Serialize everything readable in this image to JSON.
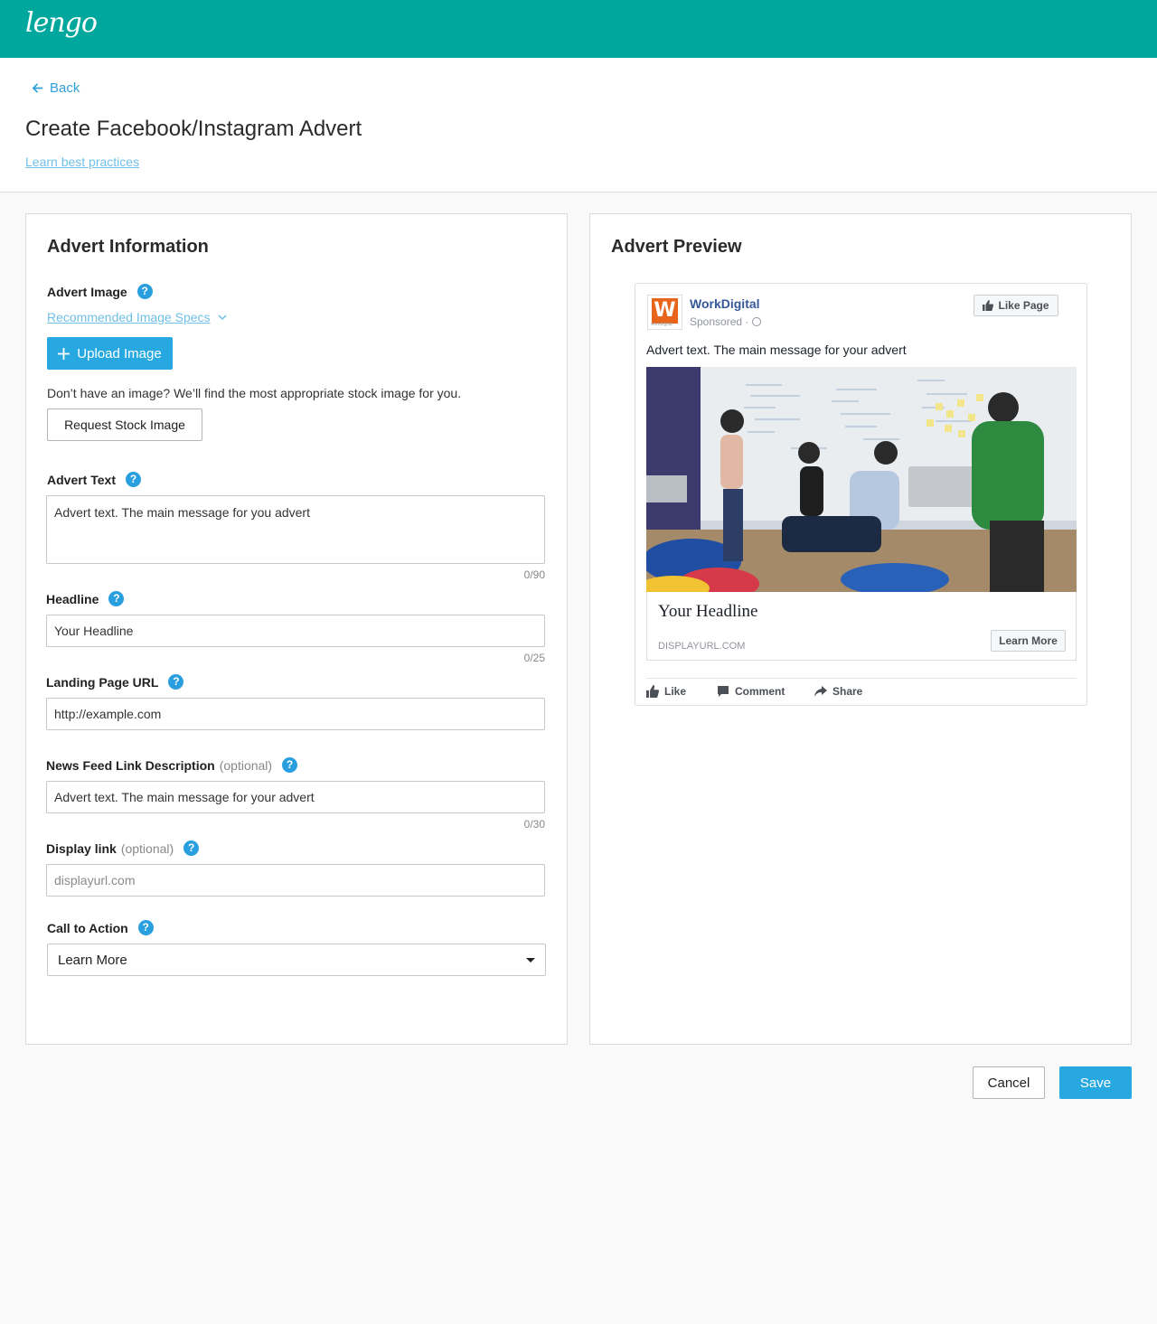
{
  "app": {
    "logo": "lengo"
  },
  "header": {
    "back_label": "Back",
    "title": "Create Facebook/Instagram Advert",
    "best_practices_link": "Learn best practices"
  },
  "form": {
    "title": "Advert Information",
    "advert_image": {
      "label": "Advert Image",
      "specs_link": "Recommended Image Specs",
      "upload_label": "Upload Image",
      "stock_note": "Don’t have an image? We’ll find the most appropriate stock image for you.",
      "stock_button": "Request Stock Image"
    },
    "advert_text": {
      "label": "Advert Text",
      "value": "Advert text. The main message for you advert",
      "counter": "0/90"
    },
    "headline": {
      "label": "Headline",
      "value": "Your Headline",
      "counter": "0/25"
    },
    "landing_url": {
      "label": "Landing Page URL",
      "value": "http://example.com"
    },
    "news_feed_desc": {
      "label": "News Feed Link Description",
      "optional": "(optional)",
      "value": "Advert text. The main message for your advert",
      "counter": "0/30"
    },
    "display_link": {
      "label": "Display link",
      "optional": "(optional)",
      "value": "",
      "placeholder": "displayurl.com"
    },
    "call_to_action": {
      "label": "Call to Action",
      "selected": "Learn More"
    }
  },
  "preview": {
    "title": "Advert Preview",
    "page_name": "WorkDigital",
    "logo_letter": "W",
    "logo_sub": "workdigital",
    "sponsored": "Sponsored ·",
    "like_page": "Like Page",
    "post_text": "Advert text. The main message for your advert",
    "headline": "Your Headline",
    "display_url": "DISPLAYURL.COM",
    "cta": "Learn More",
    "actions": {
      "like": "Like",
      "comment": "Comment",
      "share": "Share"
    }
  },
  "footer": {
    "cancel": "Cancel",
    "save": "Save"
  },
  "colors": {
    "brand": "#00a79d",
    "primary": "#28a8e0",
    "help": "#2a9fdf",
    "link": "#6fbfe6",
    "fb_blue": "#365899",
    "logo_orange": "#e8641b"
  },
  "icons": [
    "arrow-left-icon",
    "help-icon",
    "chevron-down-icon",
    "plus-icon",
    "thumbs-up-icon",
    "comment-icon",
    "share-icon",
    "globe-icon",
    "caret-down-icon"
  ]
}
